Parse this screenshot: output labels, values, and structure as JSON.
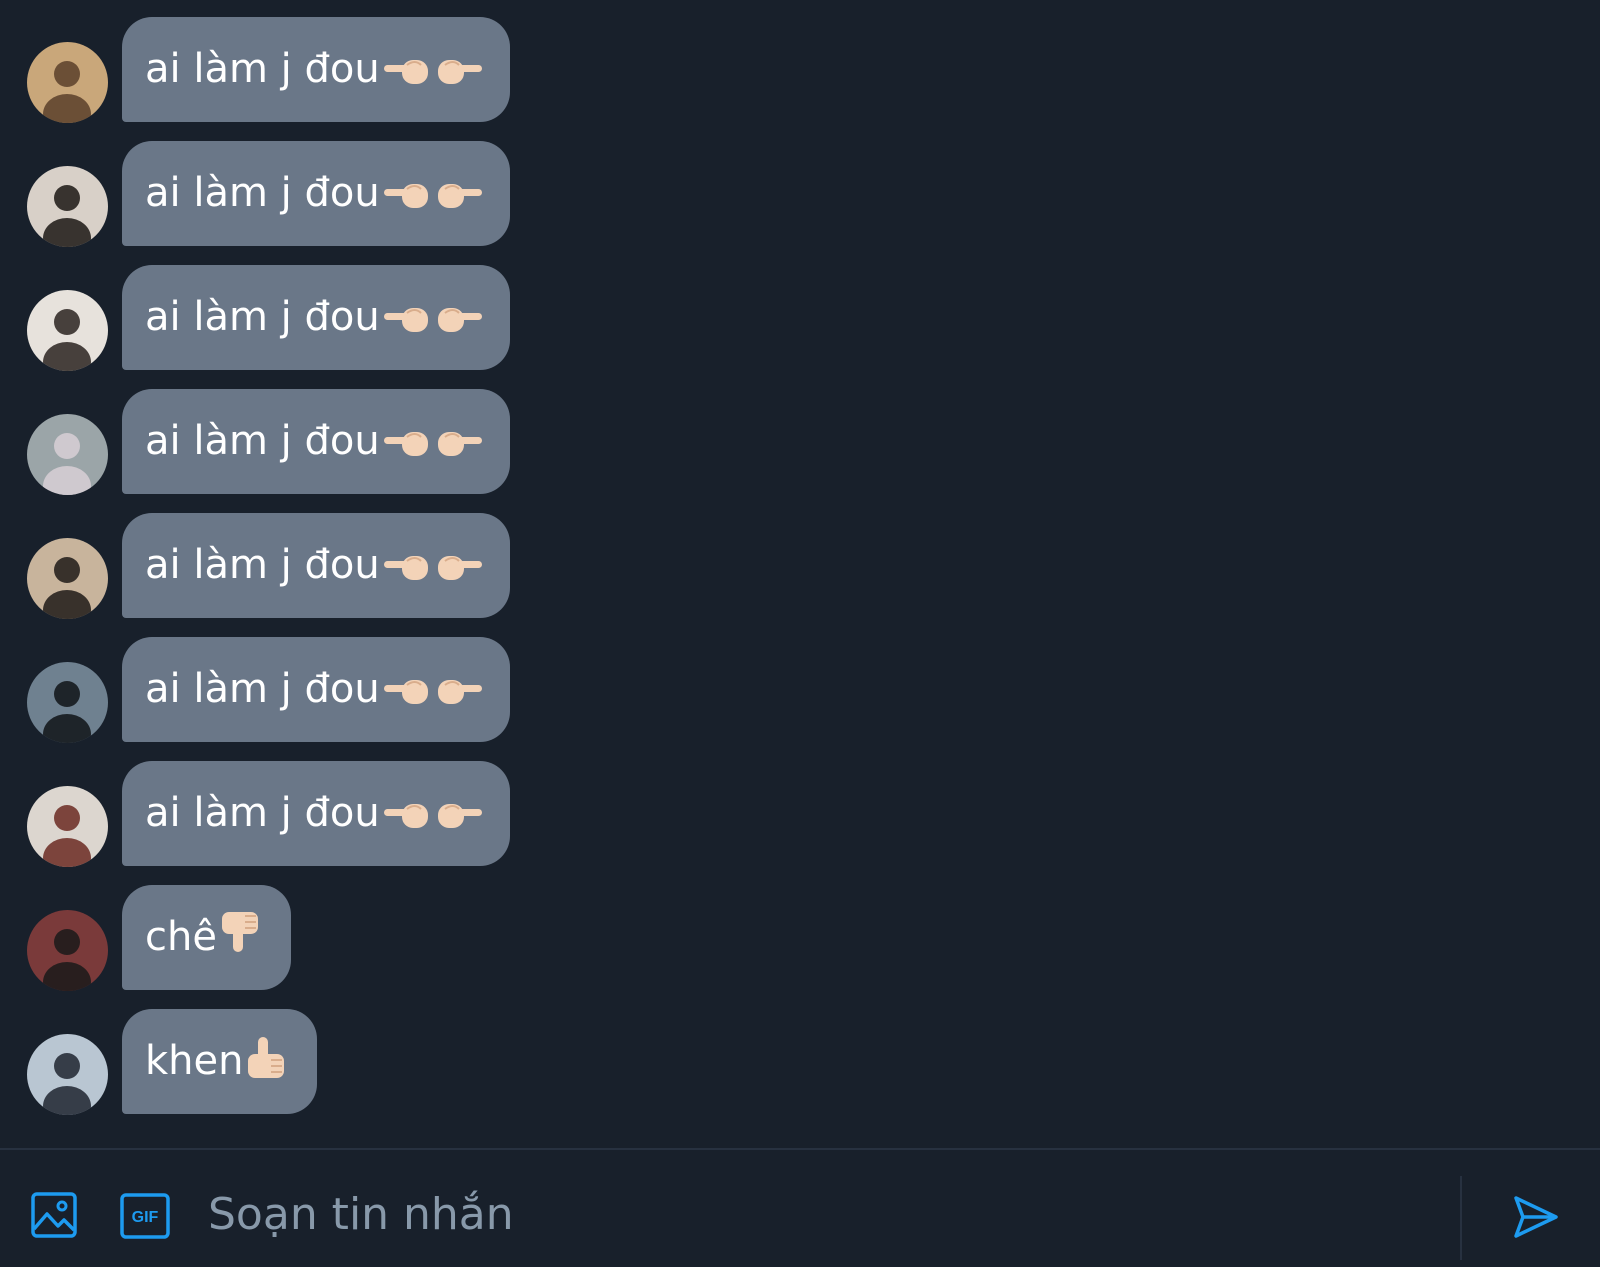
{
  "colors": {
    "background": "#18202b",
    "bubble": "#6a7788",
    "accent": "#1d9bf0",
    "placeholder": "#8899aa"
  },
  "messages": [
    {
      "text": "ai làm j đou",
      "emojis": [
        "point-left",
        "point-right"
      ],
      "avatar": {
        "bg": "#c9a77a",
        "fg": "#5b3f2a"
      }
    },
    {
      "text": "ai làm j đou",
      "emojis": [
        "point-left",
        "point-right"
      ],
      "avatar": {
        "bg": "#d8d0c8",
        "fg": "#1c1714"
      }
    },
    {
      "text": "ai làm j đou",
      "emojis": [
        "point-left",
        "point-right"
      ],
      "avatar": {
        "bg": "#e7e2dc",
        "fg": "#2a2320"
      }
    },
    {
      "text": "ai làm j đou",
      "emojis": [
        "point-left",
        "point-right"
      ],
      "avatar": {
        "bg": "#9ba5a8",
        "fg": "#d8cfd6"
      }
    },
    {
      "text": "ai làm j đou",
      "emojis": [
        "point-left",
        "point-right"
      ],
      "avatar": {
        "bg": "#c8b49c",
        "fg": "#1e1a18"
      }
    },
    {
      "text": "ai làm j đou",
      "emojis": [
        "point-left",
        "point-right"
      ],
      "avatar": {
        "bg": "#6f8190",
        "fg": "#111418"
      }
    },
    {
      "text": "ai làm j đou",
      "emojis": [
        "point-left",
        "point-right"
      ],
      "avatar": {
        "bg": "#dcd6cf",
        "fg": "#6b2a22"
      }
    },
    {
      "text": "chê",
      "emojis": [
        "thumbs-down"
      ],
      "avatar": {
        "bg": "#7a3a3a",
        "fg": "#1a1a1a"
      }
    },
    {
      "text": "khen",
      "emojis": [
        "thumbs-up"
      ],
      "avatar": {
        "bg": "#b9c6d2",
        "fg": "#1e2530"
      }
    }
  ],
  "composer": {
    "placeholder": "Soạn tin nhắn",
    "value": "",
    "image_icon": "image-icon",
    "gif_icon": "gif-icon",
    "gif_label": "GIF",
    "send_icon": "send-icon"
  }
}
